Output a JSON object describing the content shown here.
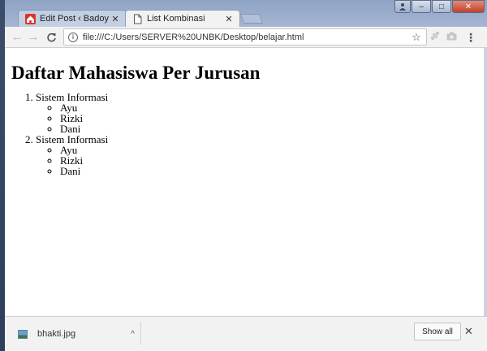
{
  "window": {
    "buttons": {
      "minimize": "–",
      "maximize": "□",
      "close": "✕"
    }
  },
  "tabs": [
    {
      "title": "Edit Post ‹ Badoy Studio",
      "close": "✕",
      "active": false,
      "favicon": "house-icon"
    },
    {
      "title": "List Kombinasi",
      "close": "✕",
      "active": true,
      "favicon": "page-icon"
    }
  ],
  "toolbar": {
    "back": "←",
    "forward": "→",
    "reload": "C",
    "url": "file:///C:/Users/SERVER%20UNBK/Desktop/belajar.html",
    "bookmark": "☆",
    "menu": "⋮"
  },
  "page": {
    "heading": "Daftar Mahasiswa Per Jurusan",
    "jurusan": [
      {
        "name": "Sistem Informasi",
        "students": [
          "Ayu",
          "Rizki",
          "Dani"
        ]
      },
      {
        "name": "Sistem Informasi",
        "students": [
          "Ayu",
          "Rizki",
          "Dani"
        ]
      }
    ]
  },
  "downloads": {
    "file_name": "bhakti.jpg",
    "chevron": "^",
    "show_all": "Show all",
    "close": "✕"
  },
  "colors": {
    "titlebar": "#a5b6d3",
    "toolbar": "#f2f2f2",
    "close_button": "#c2412a"
  }
}
